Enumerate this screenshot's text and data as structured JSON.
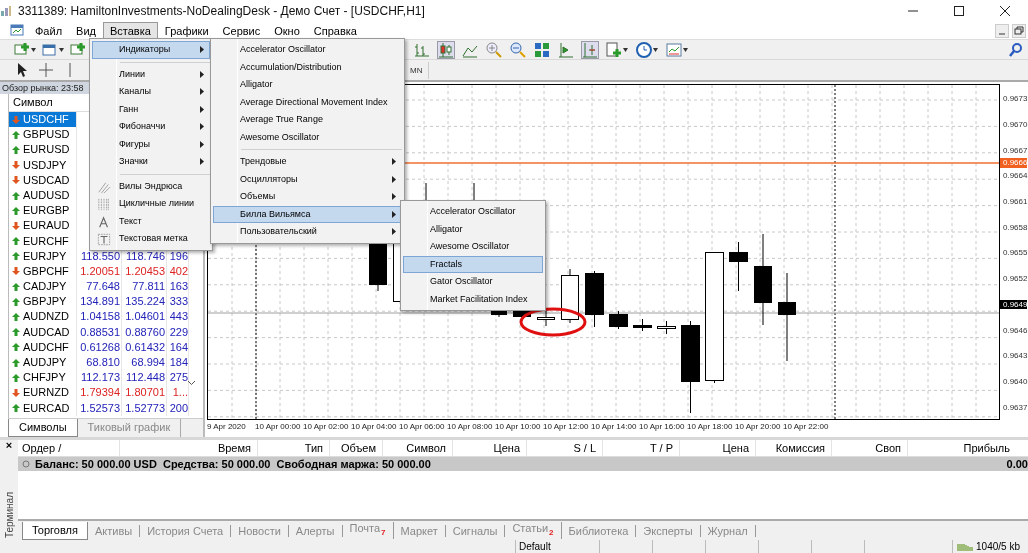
{
  "window": {
    "title": "3311389: HamiltonInvestments-NoDealingDesk - Демо Счет - [USDCHF,H1]"
  },
  "menu_bar": [
    {
      "label": "Файл",
      "selected": false
    },
    {
      "label": "Вид",
      "selected": false
    },
    {
      "label": "Вставка",
      "selected": true
    },
    {
      "label": "Графики",
      "selected": false
    },
    {
      "label": "Сервис",
      "selected": false
    },
    {
      "label": "Окно",
      "selected": false
    },
    {
      "label": "Справка",
      "selected": false
    }
  ],
  "insert_menu": {
    "items": [
      {
        "kind": "item",
        "label": "Индикаторы",
        "submenu": true,
        "selected": true
      },
      {
        "kind": "separator"
      },
      {
        "kind": "item",
        "label": "Линии",
        "submenu": true,
        "selected": false
      },
      {
        "kind": "item",
        "label": "Каналы",
        "submenu": true,
        "selected": false
      },
      {
        "kind": "item",
        "label": "Ганн",
        "submenu": true,
        "selected": false
      },
      {
        "kind": "item",
        "label": "Фибоначчи",
        "submenu": true,
        "selected": false
      },
      {
        "kind": "item",
        "label": "Фигуры",
        "submenu": true,
        "selected": false
      },
      {
        "kind": "item",
        "label": "Значки",
        "submenu": true,
        "selected": false
      },
      {
        "kind": "separator"
      },
      {
        "kind": "tool",
        "label": "Вилы Эндрюса",
        "submenu": false,
        "selected": false
      },
      {
        "kind": "tool",
        "label": "Цикличные линии",
        "submenu": false,
        "selected": false
      },
      {
        "kind": "tool",
        "label": "Текст",
        "submenu": false,
        "selected": false
      },
      {
        "kind": "tool",
        "label": "Текстовая метка",
        "submenu": false,
        "selected": false
      }
    ]
  },
  "indicators_menu": {
    "items": [
      {
        "kind": "item",
        "label": "Accelerator Oscillator",
        "submenu": false,
        "selected": false
      },
      {
        "kind": "item",
        "label": "Accumulation/Distribution",
        "submenu": false,
        "selected": false
      },
      {
        "kind": "item",
        "label": "Alligator",
        "submenu": false,
        "selected": false
      },
      {
        "kind": "item",
        "label": "Average Directional Movement Index",
        "submenu": false,
        "selected": false
      },
      {
        "kind": "item",
        "label": "Average True Range",
        "submenu": false,
        "selected": false
      },
      {
        "kind": "item",
        "label": "Awesome Oscillator",
        "submenu": false,
        "selected": false
      },
      {
        "kind": "separator"
      },
      {
        "kind": "item",
        "label": "Трендовые",
        "submenu": true,
        "selected": false
      },
      {
        "kind": "item",
        "label": "Осцилляторы",
        "submenu": true,
        "selected": false
      },
      {
        "kind": "item",
        "label": "Объемы",
        "submenu": true,
        "selected": false
      },
      {
        "kind": "item",
        "label": "Билла Вильямса",
        "submenu": true,
        "selected": true
      },
      {
        "kind": "item",
        "label": "Пользовательский",
        "submenu": true,
        "selected": false
      }
    ]
  },
  "bill_williams_menu": {
    "items": [
      {
        "kind": "item",
        "label": "Accelerator Oscillator",
        "submenu": false,
        "selected": false
      },
      {
        "kind": "item",
        "label": "Alligator",
        "submenu": false,
        "selected": false
      },
      {
        "kind": "item",
        "label": "Awesome Oscillator",
        "submenu": false,
        "selected": false
      },
      {
        "kind": "item",
        "label": "Fractals",
        "submenu": false,
        "selected": true
      },
      {
        "kind": "item",
        "label": "Gator Oscillator",
        "submenu": false,
        "selected": false
      },
      {
        "kind": "item",
        "label": "Market Facilitation Index",
        "submenu": false,
        "selected": false
      }
    ]
  },
  "toolbar": {
    "period": "MN"
  },
  "market_watch": {
    "title": "Обзор рынка: 23:58",
    "symbol_column": "Символ",
    "rows": [
      {
        "symbol": "USDCHF",
        "down": true,
        "selected": true
      },
      {
        "symbol": "GBPUSD",
        "down": false,
        "selected": false
      },
      {
        "symbol": "EURUSD",
        "down": false,
        "selected": false
      },
      {
        "symbol": "USDJPY",
        "down": true,
        "selected": false
      },
      {
        "symbol": "USDCAD",
        "down": true,
        "selected": false
      },
      {
        "symbol": "AUDUSD",
        "down": false,
        "selected": false
      },
      {
        "symbol": "EURGBP",
        "down": false,
        "selected": false
      },
      {
        "symbol": "EURAUD",
        "down": true,
        "selected": false
      },
      {
        "symbol": "EURCHF",
        "down": false,
        "selected": false
      },
      {
        "symbol": "EURJPY",
        "down": false,
        "bid": "118.550",
        "ask": "118.746",
        "spread": "196",
        "selected": false
      },
      {
        "symbol": "GBPCHF",
        "down": true,
        "bid": "1.20051",
        "ask": "1.20453",
        "spread": "402",
        "selected": false
      },
      {
        "symbol": "CADJPY",
        "down": false,
        "bid": "77.648",
        "ask": "77.811",
        "spread": "163",
        "selected": false
      },
      {
        "symbol": "GBPJPY",
        "down": false,
        "bid": "134.891",
        "ask": "135.224",
        "spread": "333",
        "selected": false
      },
      {
        "symbol": "AUDNZD",
        "down": false,
        "bid": "1.04158",
        "ask": "1.04601",
        "spread": "443",
        "selected": false
      },
      {
        "symbol": "AUDCAD",
        "down": false,
        "bid": "0.88531",
        "ask": "0.88760",
        "spread": "229",
        "selected": false
      },
      {
        "symbol": "AUDCHF",
        "down": false,
        "bid": "0.61268",
        "ask": "0.61432",
        "spread": "164",
        "selected": false
      },
      {
        "symbol": "AUDJPY",
        "down": false,
        "bid": "68.810",
        "ask": "68.994",
        "spread": "184",
        "selected": false
      },
      {
        "symbol": "CHFJPY",
        "down": false,
        "bid": "112.173",
        "ask": "112.448",
        "spread": "275",
        "selected": false
      },
      {
        "symbol": "EURNZD",
        "down": true,
        "bid": "1.79394",
        "ask": "1.80701",
        "spread": "1...",
        "selected": false
      },
      {
        "symbol": "EURCAD",
        "down": false,
        "bid": "1.52573",
        "ask": "1.52773",
        "spread": "200",
        "selected": false
      }
    ],
    "tabs": [
      {
        "label": "Символы",
        "selected": true
      },
      {
        "label": "Тиковый график",
        "selected": false
      }
    ]
  },
  "chart": {
    "price_labels": [
      {
        "text": "0.9673",
        "kind": "tick"
      },
      {
        "text": "0.9670",
        "kind": "tick"
      },
      {
        "text": "0.9667",
        "kind": "tick"
      },
      {
        "text": "0.9664",
        "kind": "tick"
      },
      {
        "text": "0.9661",
        "kind": "tick"
      },
      {
        "text": "0.9658",
        "kind": "tick"
      },
      {
        "text": "0.9655",
        "kind": "tick"
      },
      {
        "text": "0.9652",
        "kind": "tick"
      },
      {
        "text": "0.9649",
        "kind": "bid"
      },
      {
        "text": "0.9646",
        "kind": "tick"
      },
      {
        "text": "0.9643",
        "kind": "tick"
      },
      {
        "text": "0.9640",
        "kind": "tick"
      },
      {
        "text": "0.9637",
        "kind": "tick"
      }
    ],
    "ask_label": "0.9666",
    "time_labels": [
      "9 Apr 2020",
      "10 Apr 00:00",
      "10 Apr 02:00",
      "10 Apr 04:00",
      "10 Apr 06:00",
      "10 Apr 08:00",
      "10 Apr 10:00",
      "10 Apr 12:00",
      "10 Apr 14:00",
      "10 Apr 16:00",
      "10 Apr 18:00",
      "10 Apr 20:00",
      "10 Apr 22:00"
    ]
  },
  "terminal": {
    "title": "Терминал",
    "close": "×",
    "columns": [
      "Ордер /",
      "Время",
      "Тип",
      "Объем",
      "Символ",
      "Цена",
      "S / L",
      "T / P",
      "Цена",
      "Комиссия",
      "Своп",
      "Прибыль"
    ],
    "balance": "Баланс: 50 000.00 USD  Средства: 50 000.00  Свободная маржа: 50 000.00",
    "profit": "0.00",
    "tabs": [
      {
        "label": "Торговля",
        "selected": true
      },
      {
        "label": "Активы",
        "selected": false
      },
      {
        "label": "История Счета",
        "selected": false
      },
      {
        "label": "Новости",
        "selected": false
      },
      {
        "label": "Алерты",
        "selected": false
      },
      {
        "label": "Почта",
        "badge": "7",
        "selected": false
      },
      {
        "label": "Маркет",
        "selected": false
      },
      {
        "label": "Сигналы",
        "selected": false
      },
      {
        "label": "Статьи",
        "badge": "2",
        "selected": false
      },
      {
        "label": "Библиотека",
        "selected": false
      },
      {
        "label": "Эксперты",
        "selected": false
      },
      {
        "label": "Журнал",
        "selected": false
      }
    ]
  },
  "status_bar": {
    "profile": "Default",
    "traffic": "1040/5 kb"
  }
}
